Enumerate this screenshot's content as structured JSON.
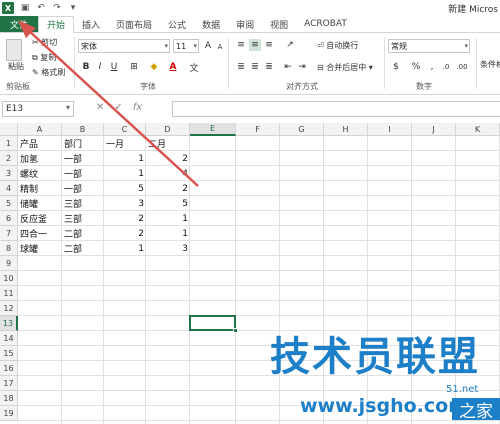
{
  "app": {
    "title": "新建 Micros",
    "logo": "X"
  },
  "tabs": [
    "文件",
    "开始",
    "插入",
    "页面布局",
    "公式",
    "数据",
    "审阅",
    "视图",
    "ACROBAT"
  ],
  "ribbon": {
    "clipboard": {
      "paste": "粘贴",
      "cut": "剪切",
      "copy": "复制",
      "format_painter": "格式刷",
      "label": "剪贴板"
    },
    "font": {
      "name": "宋体",
      "size": "11",
      "bold": "B",
      "italic": "I",
      "underline": "U",
      "label": "字体",
      "font_color": "A"
    },
    "alignment": {
      "wrap_text": "自动换行",
      "merge_center": "合并后居中",
      "label": "对齐方式"
    },
    "number": {
      "format": "常规",
      "percent": "%",
      "comma": ",",
      "label": "数字"
    },
    "styles": {
      "conditional": "条件格"
    }
  },
  "formula_bar": {
    "name_box": "E13",
    "cancel": "✕",
    "enter": "✓",
    "fx": "fx"
  },
  "columns": [
    "A",
    "B",
    "C",
    "D",
    "E",
    "F",
    "G",
    "H",
    "I",
    "J",
    "K"
  ],
  "rows": [
    "1",
    "2",
    "3",
    "4",
    "5",
    "6",
    "7",
    "8",
    "9",
    "10",
    "11",
    "12",
    "13",
    "14",
    "15",
    "16",
    "17",
    "18",
    "19"
  ],
  "table": {
    "headers": [
      "产品",
      "部门",
      "一月",
      "二月"
    ],
    "rows": [
      [
        "加氢",
        "一部",
        "1",
        "2"
      ],
      [
        "螺纹",
        "一部",
        "1",
        "4"
      ],
      [
        "精制",
        "一部",
        "5",
        "2"
      ],
      [
        "储罐",
        "三部",
        "3",
        "5"
      ],
      [
        "反应釜",
        "三部",
        "2",
        "1"
      ],
      [
        "四合一",
        "二部",
        "2",
        "1"
      ],
      [
        "球罐",
        "二部",
        "1",
        "3"
      ]
    ]
  },
  "watermark": {
    "main": "技术员联盟",
    "url": "www.jsgho.com",
    "tag": "之家",
    "side": "51.net"
  },
  "accent": "#217346"
}
